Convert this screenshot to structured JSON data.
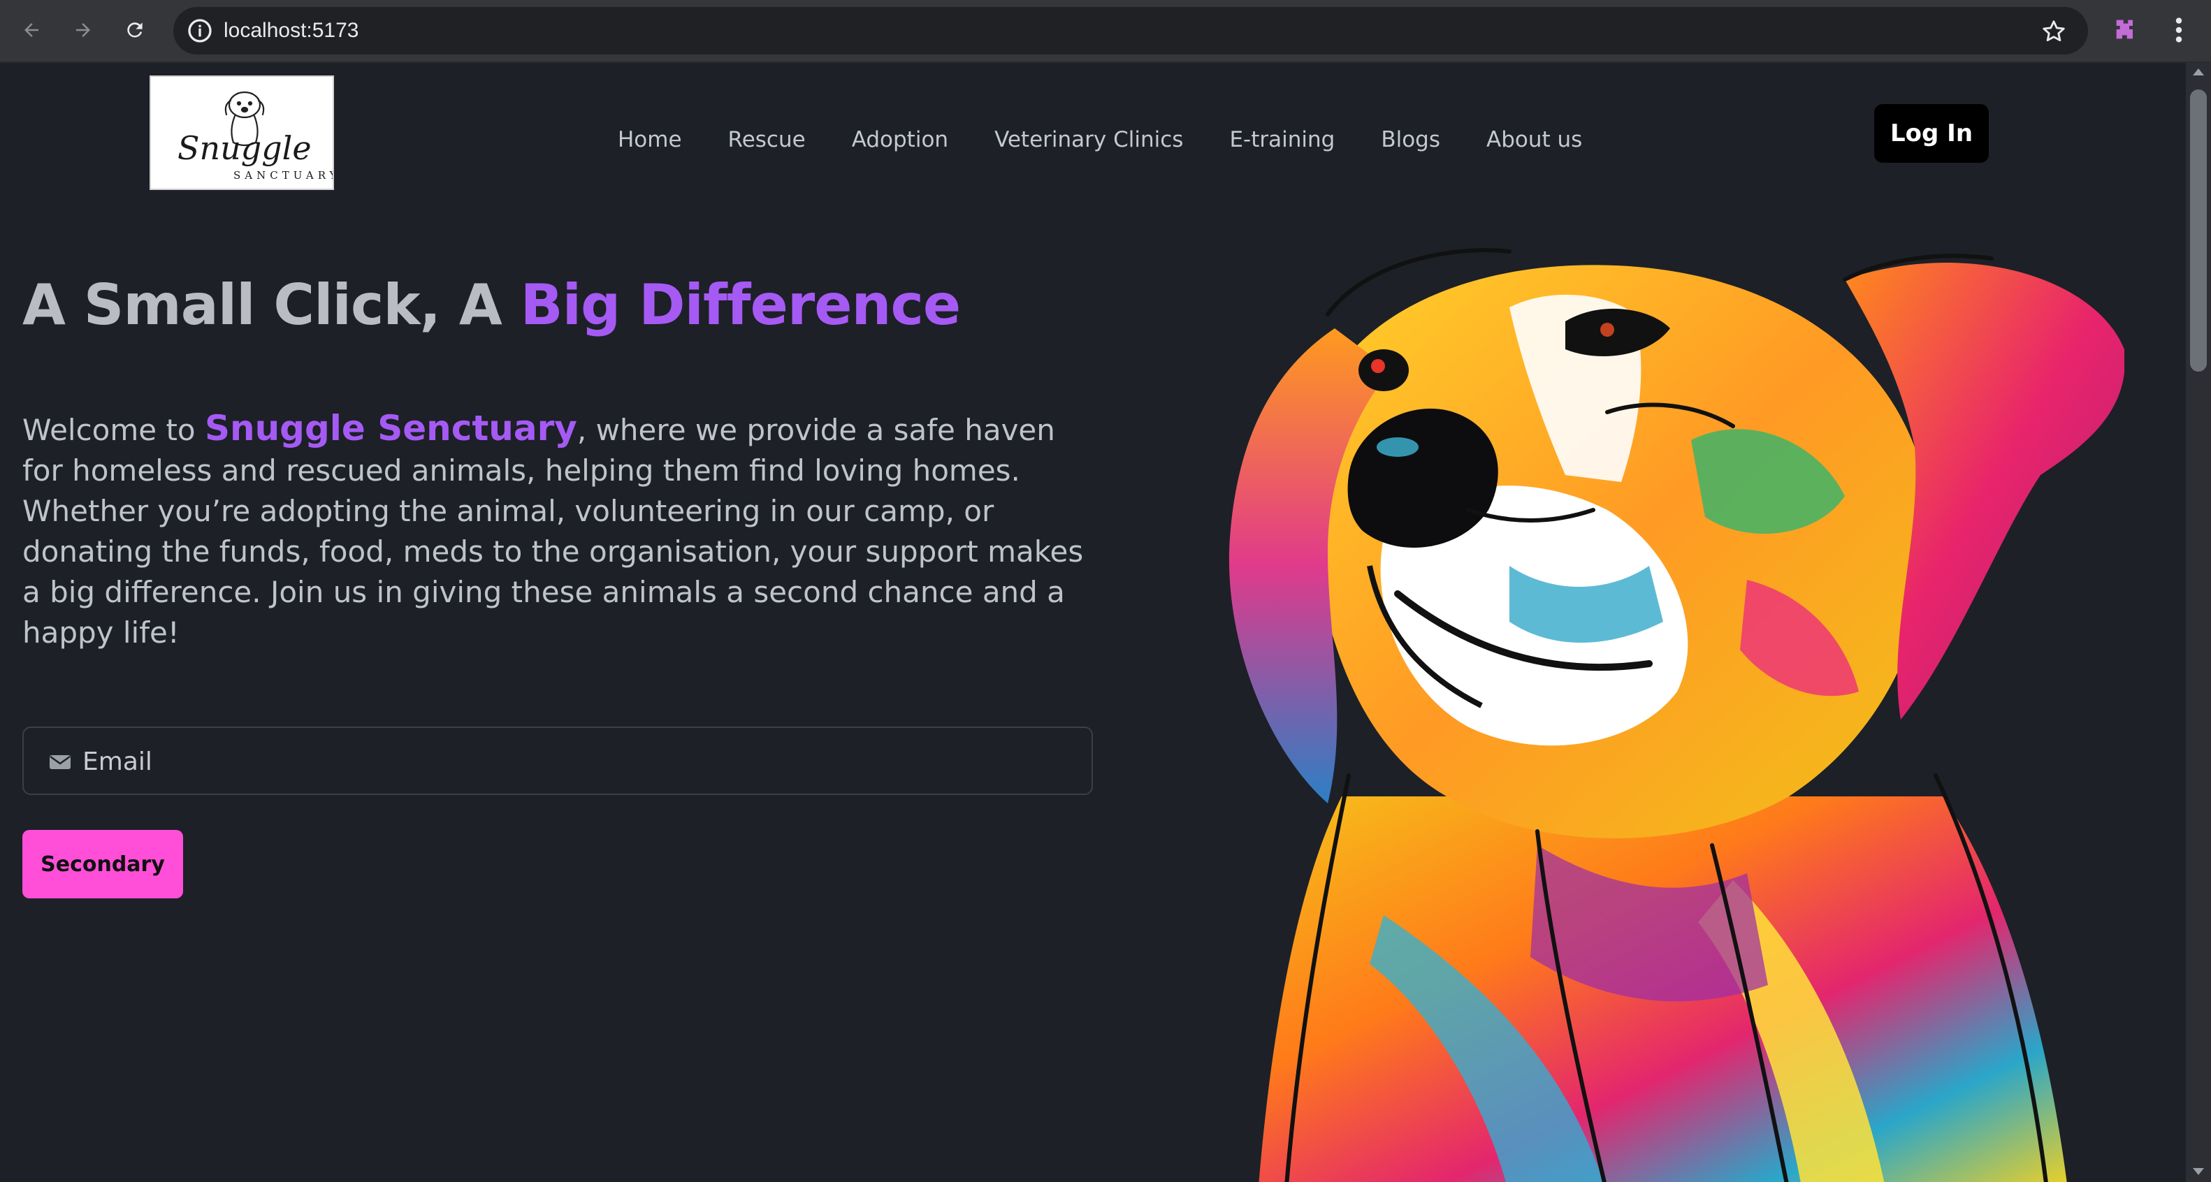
{
  "browser": {
    "url": "localhost:5173"
  },
  "logo": {
    "script_text": "Snuggle",
    "caps_text": "SANCTUARY"
  },
  "nav": {
    "items": [
      {
        "label": "Home"
      },
      {
        "label": "Rescue"
      },
      {
        "label": "Adoption"
      },
      {
        "label": "Veterinary Clinics"
      },
      {
        "label": "E-training"
      },
      {
        "label": "Blogs"
      },
      {
        "label": "About us"
      }
    ],
    "login_label": "Log In"
  },
  "hero": {
    "headline_plain": "A Small Click, A ",
    "headline_accent": "Big Difference",
    "intro_prefix": "Welcome to ",
    "intro_brand": "Snuggle Senctuary",
    "intro_rest": ", where we provide a safe haven for homeless and rescued animals, helping them find loving homes. Whether you’re adopting the animal, volunteering in our camp, or donating the funds, food, meds to the organisation, your support makes a big difference. Join us in giving these animals a second chance and a happy life!",
    "email_placeholder": "Email",
    "secondary_label": "Secondary"
  },
  "colors": {
    "accent_purple": "#a55af4",
    "button_pink": "#ff4fd8",
    "background": "#1d2027"
  },
  "icons": {
    "back": "arrow-left-icon",
    "forward": "arrow-right-icon",
    "reload": "reload-icon",
    "site_info": "info-icon",
    "bookmark": "star-icon",
    "extension": "extension-icon",
    "menu": "kebab-menu-icon",
    "email": "mail-icon"
  }
}
